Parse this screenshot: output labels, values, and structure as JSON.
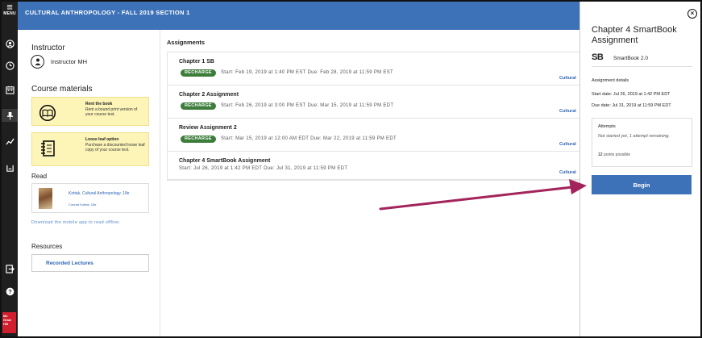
{
  "header": {
    "course_title": "CULTURAL ANTHROPOLOGY - FALL 2019 SECTION 1"
  },
  "rail": {
    "menu_label": "MENU"
  },
  "instructor": {
    "heading": "Instructor",
    "name": "Instructor MH"
  },
  "course_materials": {
    "heading": "Course materials",
    "cards": [
      {
        "title": "Rent the book",
        "text": "Rent a bound print version of your course text."
      },
      {
        "title": "Loose leaf option",
        "text": "Purchase a discounted loose leaf copy of your course text."
      }
    ]
  },
  "read": {
    "heading": "Read",
    "book_title": "Kottak, Cultural Anthropology, 18e",
    "book_author": "Conrad Kottak, 18e",
    "mobile_link": "Download the mobile app to read offline."
  },
  "resources": {
    "heading": "Resources",
    "button": "Recorded Lectures"
  },
  "assignments": {
    "heading": "Assignments",
    "items": [
      {
        "name": "Chapter 1 SB",
        "badge": "RECHARGE",
        "dates": "Start: Feb 19, 2019 at 1:40 PM EST  Due: Feb 28, 2019 at 11:59 PM EST",
        "source": "Cultural"
      },
      {
        "name": "Chapter 2 Assignment",
        "badge": "RECHARGE",
        "dates": "Start: Feb 26, 2019 at 3:00 PM EST  Due: Mar 15, 2019 at 11:59 PM EDT",
        "source": "Cultural"
      },
      {
        "name": "Review Assignment 2",
        "badge": "RECHARGE",
        "dates": "Start: Mar 15, 2019 at 12:00 AM EDT  Due: Mar 22, 2019 at 11:59 PM EDT",
        "source": "Cultural"
      },
      {
        "name": "Chapter 4 SmartBook Assignment",
        "badge": "",
        "dates": "Start: Jul 26, 2019 at 1:42 PM EDT  Due: Jul 31, 2019 at 11:59 PM EDT",
        "source": "Cultural"
      }
    ]
  },
  "panel": {
    "close_label": "×",
    "title": "Chapter 4 SmartBook Assignment",
    "smartbook_logo": "SB",
    "smartbook_label": "SmartBook 2.0",
    "details_heading": "Assignment details",
    "start_date": "Start date: Jul 26, 2019 at 1:42 PM EDT",
    "due_date": "Due date: Jul 31, 2019 at 11:59 PM EDT",
    "attempts_heading": "Attempts",
    "attempts_text": "Not started yet, 1 attempt remaining.",
    "points_value": "12",
    "points_label": "points possible",
    "begin_label": "Begin"
  },
  "colors": {
    "header_blue": "#3d72b8",
    "recharge_green": "#3c7d3a",
    "annotation_arrow": "#a3245a",
    "brand_red": "#d0202e"
  }
}
